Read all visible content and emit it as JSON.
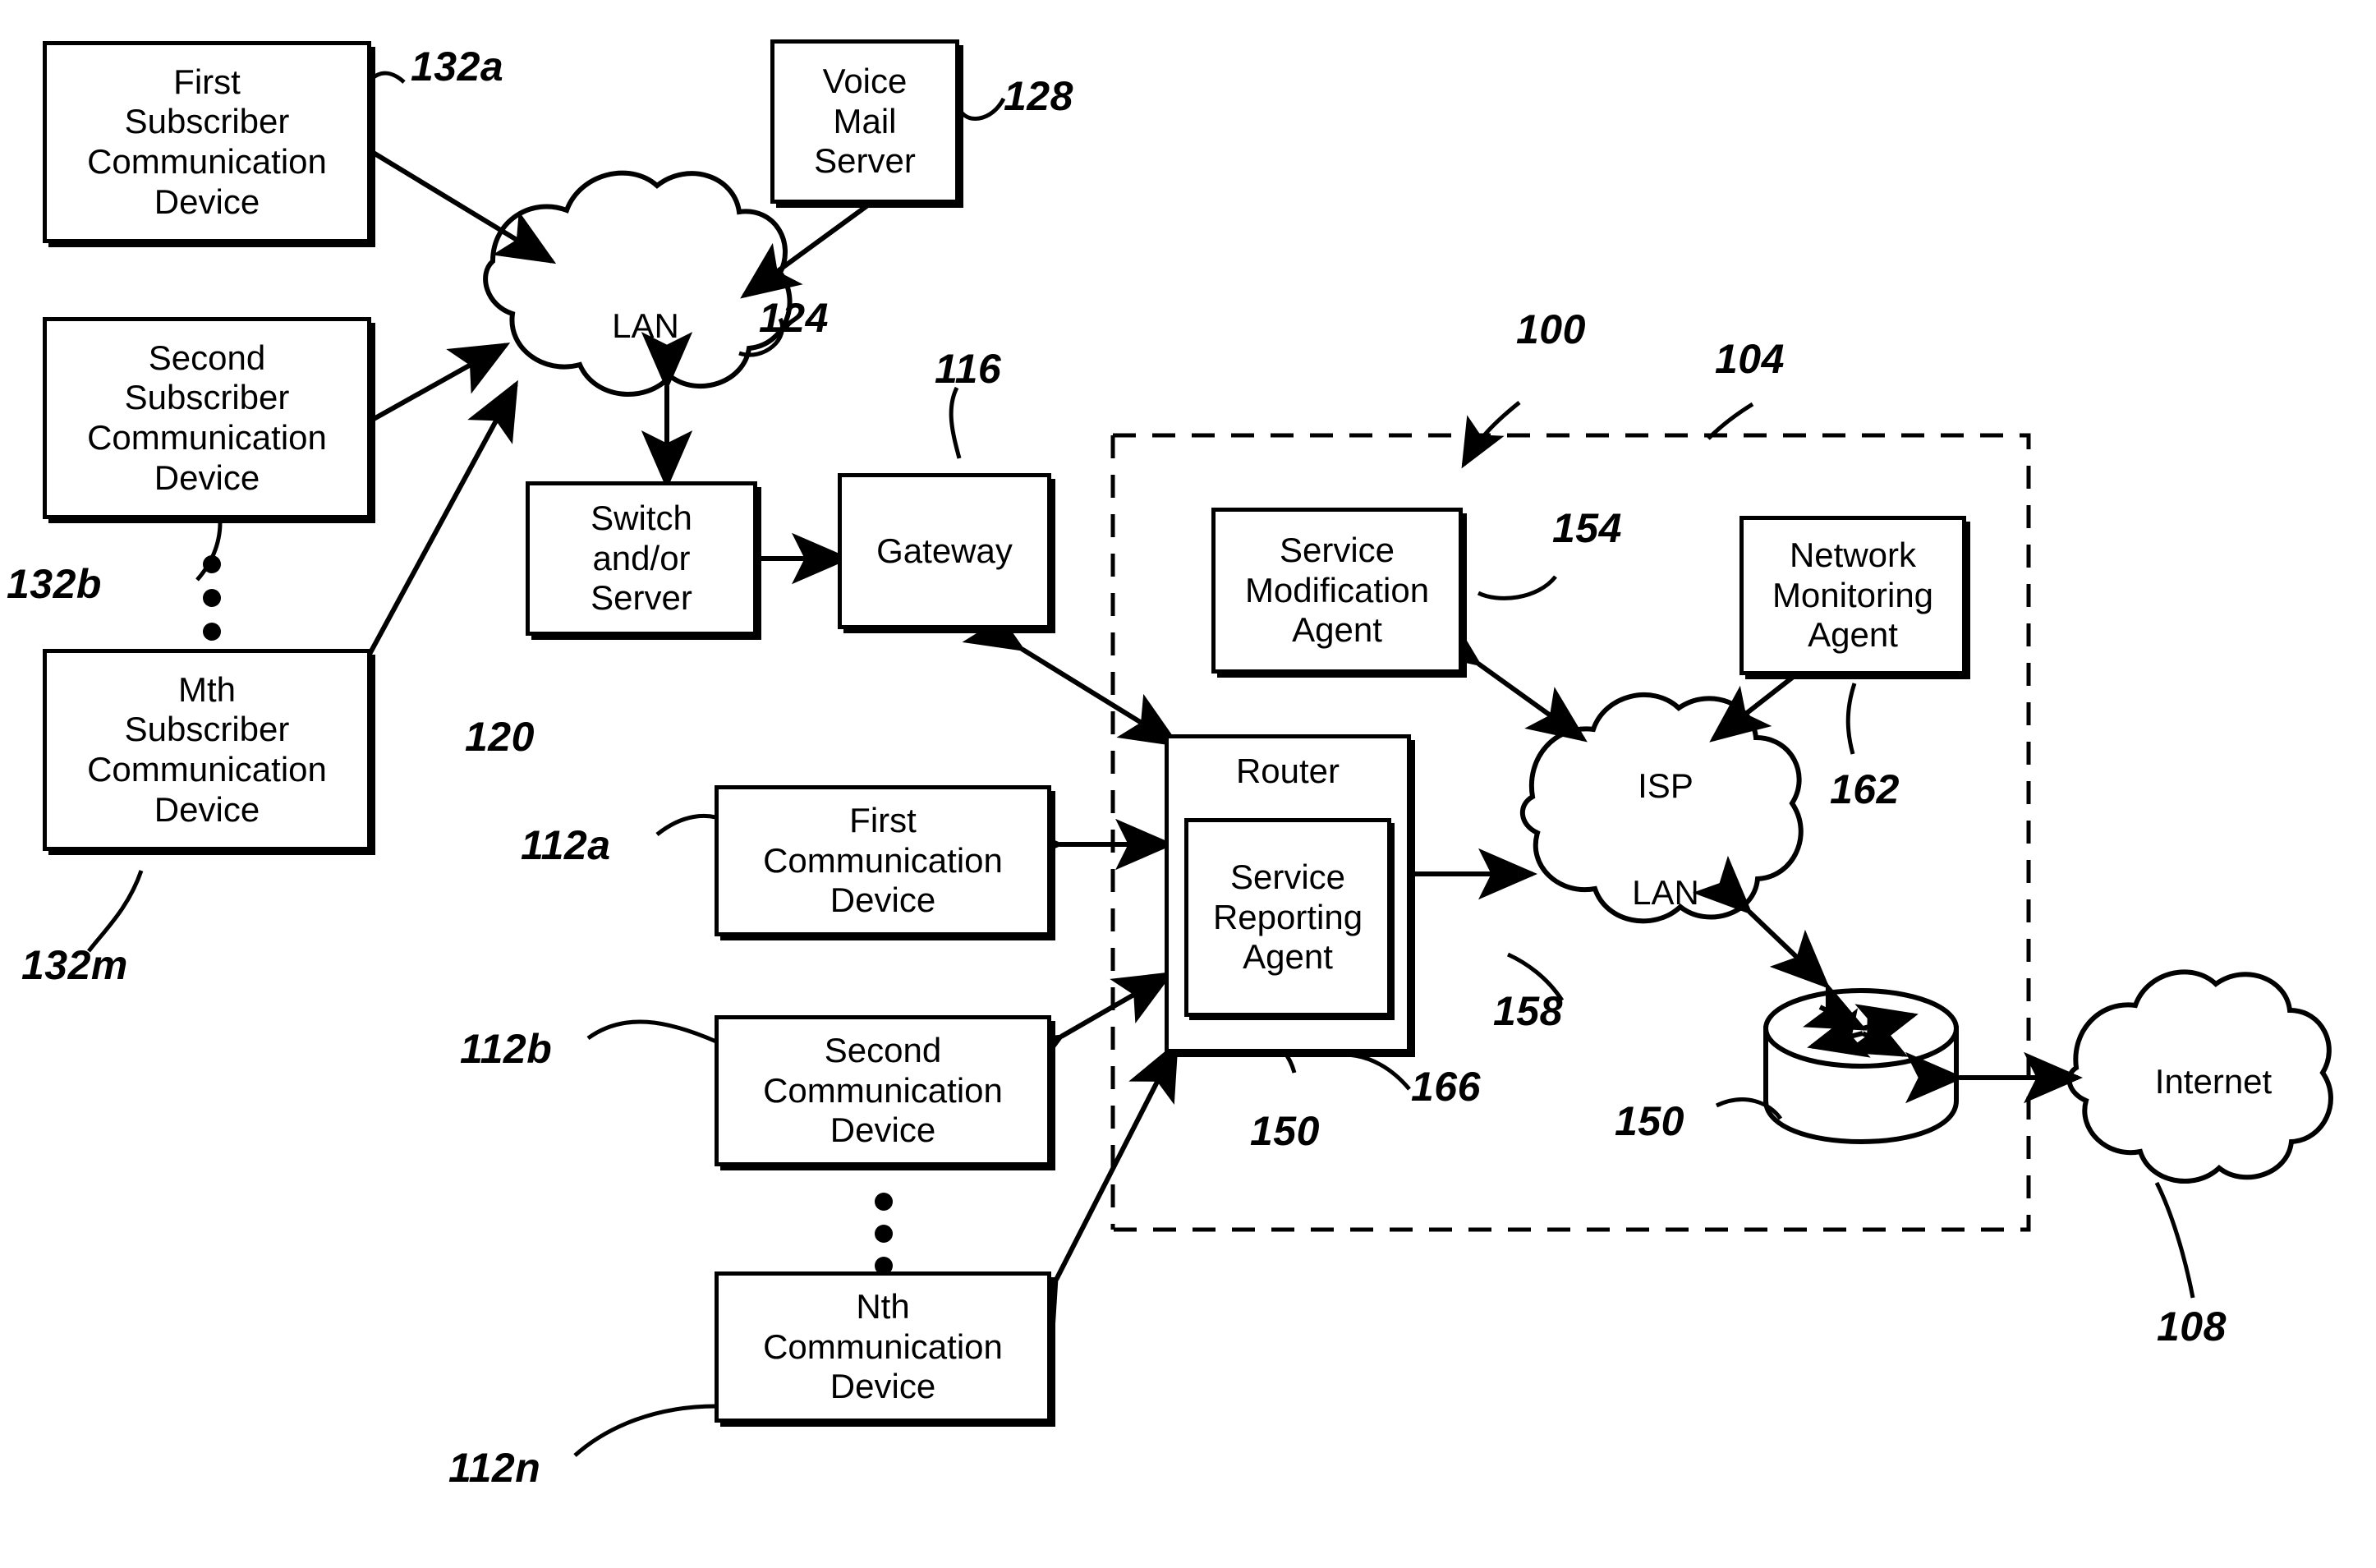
{
  "figure": {
    "title": "Service provider network architecture diagram",
    "ink_color": "#000000",
    "background": "#ffffff"
  },
  "nodes": {
    "first_subscriber_device": "First\nSubscriber\nCommunication\nDevice",
    "second_subscriber_device": "Second\nSubscriber\nCommunication\nDevice",
    "mth_subscriber_device": "Mth\nSubscriber\nCommunication\nDevice",
    "voice_mail_server": "Voice\nMail\nServer",
    "switch_server": "Switch\nand/or\nServer",
    "gateway": "Gateway",
    "first_communication_device": "First\nCommunication\nDevice",
    "second_communication_device": "Second\nCommunication\nDevice",
    "nth_communication_device": "Nth\nCommunication\nDevice",
    "router": "Router",
    "service_reporting_agent": "Service\nReporting\nAgent",
    "service_modification_agent": "Service\nModification\nAgent",
    "network_monitoring_agent": "Network\nMonitoring\nAgent"
  },
  "clouds": {
    "lan": "LAN",
    "isp_lan": "ISP\n\nLAN",
    "internet": "Internet"
  },
  "reference_numerals": {
    "system_100": "100",
    "isp_domain_104": "104",
    "internet_108": "108",
    "comm_device_a_112a": "112a",
    "comm_device_b_112b": "112b",
    "comm_device_n_112n": "112n",
    "gateway_116": "116",
    "switch_server_120": "120",
    "lan_124": "124",
    "voice_mail_128": "128",
    "subscriber_a_132a": "132a",
    "subscriber_b_132b": "132b",
    "subscriber_m_132m": "132m",
    "router_150": "150",
    "isp_router_150": "150",
    "service_mod_agent_154": "154",
    "isp_lan_158": "158",
    "network_mon_agent_162": "162",
    "service_rep_agent_166": "166"
  }
}
